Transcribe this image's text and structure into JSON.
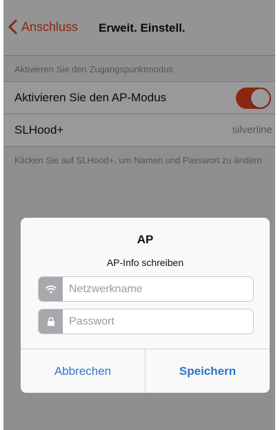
{
  "navbar": {
    "back_label": "Anschluss",
    "title": "Erweit. Einstell.",
    "back_icon": "chevron-left-icon",
    "accent_color": "#e8401f"
  },
  "settings": {
    "section_header": "Aktivieren Sie den Zugangspunktmodus",
    "ap_mode": {
      "label": "Aktivieren Sie den AP-Modus",
      "enabled": true
    },
    "network": {
      "label": "SLHood+",
      "value": "silverline"
    },
    "footer_note": "Klicken Sie auf SLHood+, um Namen und Passwort zu ändern"
  },
  "dialog": {
    "title": "AP",
    "message": "AP-Info schreiben",
    "fields": {
      "network_name": {
        "placeholder": "Netzwerkname",
        "value": "",
        "icon": "wifi-icon"
      },
      "password": {
        "placeholder": "Passwort",
        "value": "",
        "icon": "lock-icon"
      }
    },
    "cancel_label": "Abbrechen",
    "save_label": "Speichern",
    "button_color": "#2d75c9"
  }
}
